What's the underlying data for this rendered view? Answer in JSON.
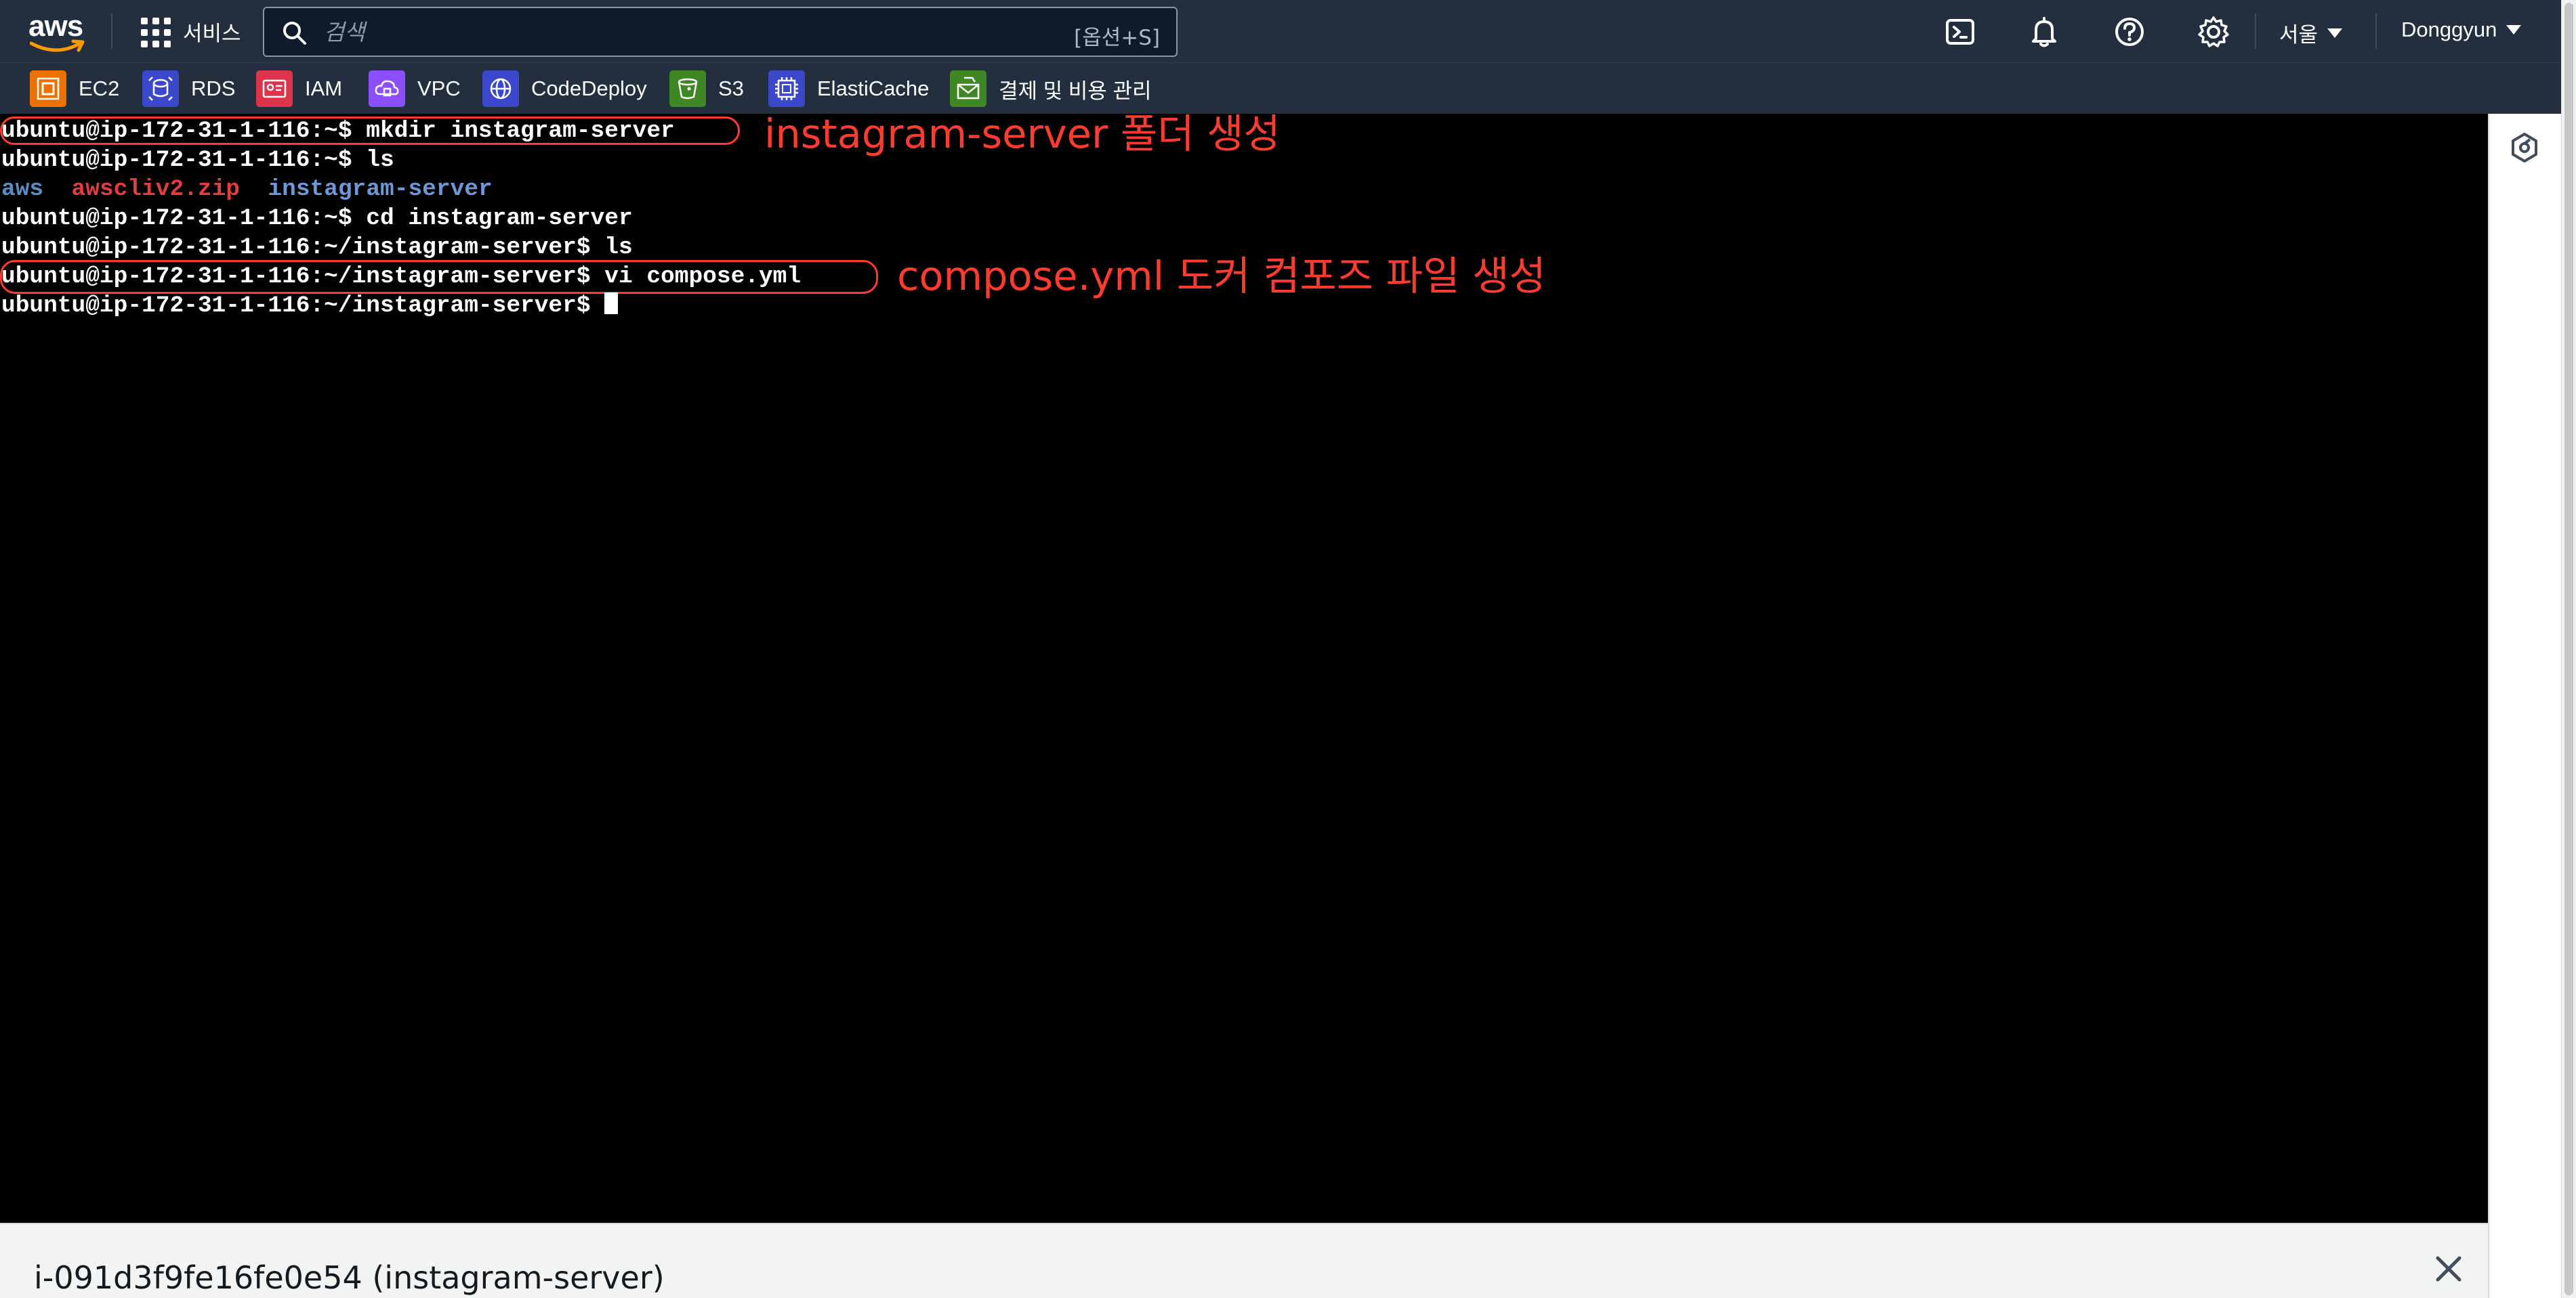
{
  "topnav": {
    "logo_text": "aws",
    "services_label": "서비스",
    "search": {
      "placeholder": "검색",
      "shortcut": "[옵션+S]"
    },
    "region": "서울",
    "account": "Donggyun"
  },
  "favorites": [
    {
      "label": "EC2",
      "color": "#ed7100"
    },
    {
      "label": "RDS",
      "color": "#3b48cc"
    },
    {
      "label": "IAM",
      "color": "#dd344c"
    },
    {
      "label": "VPC",
      "color": "#8c4fff"
    },
    {
      "label": "CodeDeploy",
      "color": "#3b48cc"
    },
    {
      "label": "S3",
      "color": "#3f8624"
    },
    {
      "label": "ElastiCache",
      "color": "#3b48cc"
    },
    {
      "label": "결제 및 비용 관리",
      "color": "#3f8624"
    }
  ],
  "terminal": {
    "lines": [
      "ubuntu@ip-172-31-1-116:~$ mkdir instagram-server",
      "ubuntu@ip-172-31-1-116:~$ ls",
      "ubuntu@ip-172-31-1-116:~$ cd instagram-server",
      "ubuntu@ip-172-31-1-116:~/instagram-server$ ls",
      "ubuntu@ip-172-31-1-116:~/instagram-server$ vi compose.yml",
      "ubuntu@ip-172-31-1-116:~/instagram-server$ "
    ],
    "ls_output": {
      "aws": "aws",
      "zip": "awscliv2.zip",
      "dir": "instagram-server"
    },
    "annotations": {
      "mkdir": "instagram-server 폴더 생성",
      "compose": "compose.yml 도커 컴포즈 파일 생성"
    }
  },
  "bottombar": {
    "instance_title": "i-091d3f9fe16fe0e54 (instagram-server)"
  }
}
